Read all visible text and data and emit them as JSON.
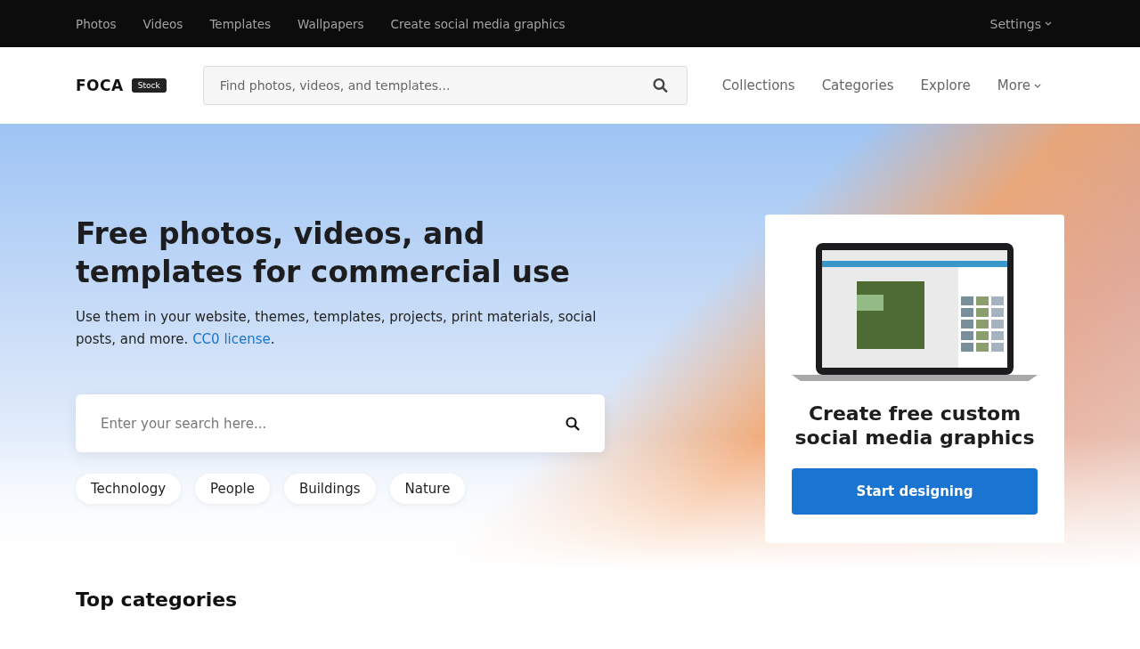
{
  "top_nav": {
    "links": [
      "Photos",
      "Videos",
      "Templates",
      "Wallpapers",
      "Create social media graphics"
    ],
    "settings": "Settings"
  },
  "header": {
    "logo": "FOCA",
    "logo_badge": "Stock",
    "search": {
      "placeholder": "Find photos, videos, and templates..."
    },
    "links": [
      "Collections",
      "Categories",
      "Explore"
    ],
    "more": "More"
  },
  "hero": {
    "title": "Free photos, videos, and templates for commercial use",
    "subtitle": "Use them in your website, themes, templates, projects, print materials, social posts, and more.",
    "license_link": "CC0 license",
    "license_suffix": ".",
    "search": {
      "placeholder": "Enter your search here..."
    },
    "tags": [
      "Technology",
      "People",
      "Buildings",
      "Nature"
    ]
  },
  "promo": {
    "title": "Create free custom social media graphics",
    "button": "Start designing"
  },
  "section_title": "Top categories"
}
